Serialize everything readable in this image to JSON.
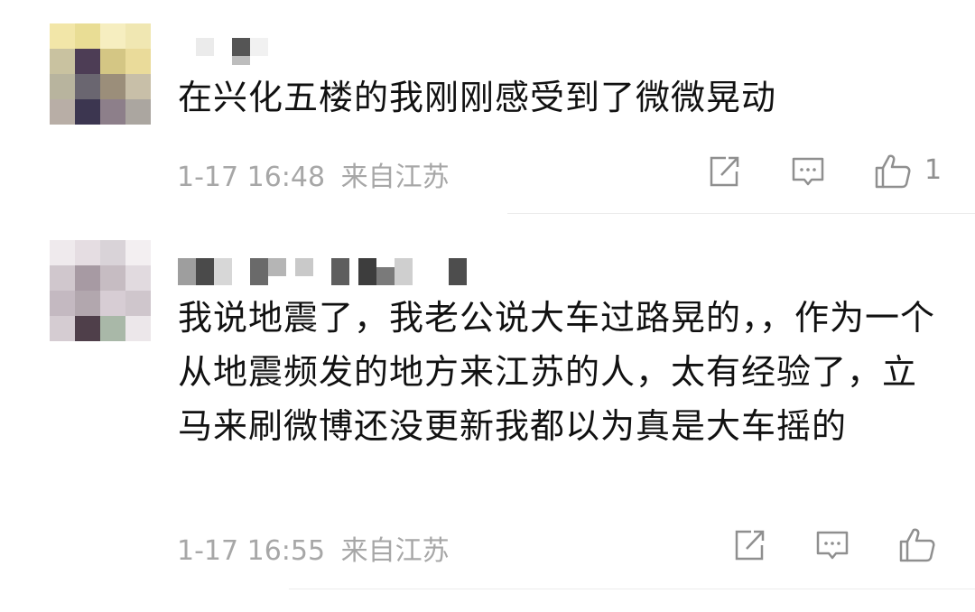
{
  "comments": [
    {
      "text": "在兴化五楼的我刚刚感受到了微微晃动",
      "timestamp": "1-17 16:48",
      "location": "来自江苏",
      "likes": "1",
      "avatar_blurred": true,
      "username_blurred": true
    },
    {
      "text": "我说地震了，我老公说大车过路晃的，，作为一个从地震频发的地方来江苏的人，太有经验了，立马来刷微博还没更新我都以为真是大车摇的",
      "timestamp": "1-17 16:55",
      "location": "来自江苏",
      "likes": "",
      "avatar_blurred": true,
      "username_blurred": true
    }
  ],
  "icons": {
    "share": "share-icon",
    "comment": "comment-icon",
    "like": "thumbs-up-icon"
  },
  "colors": {
    "text": "#111111",
    "meta": "#a7a7a7",
    "icon": "#8f8f8f",
    "divider": "#ececec"
  }
}
